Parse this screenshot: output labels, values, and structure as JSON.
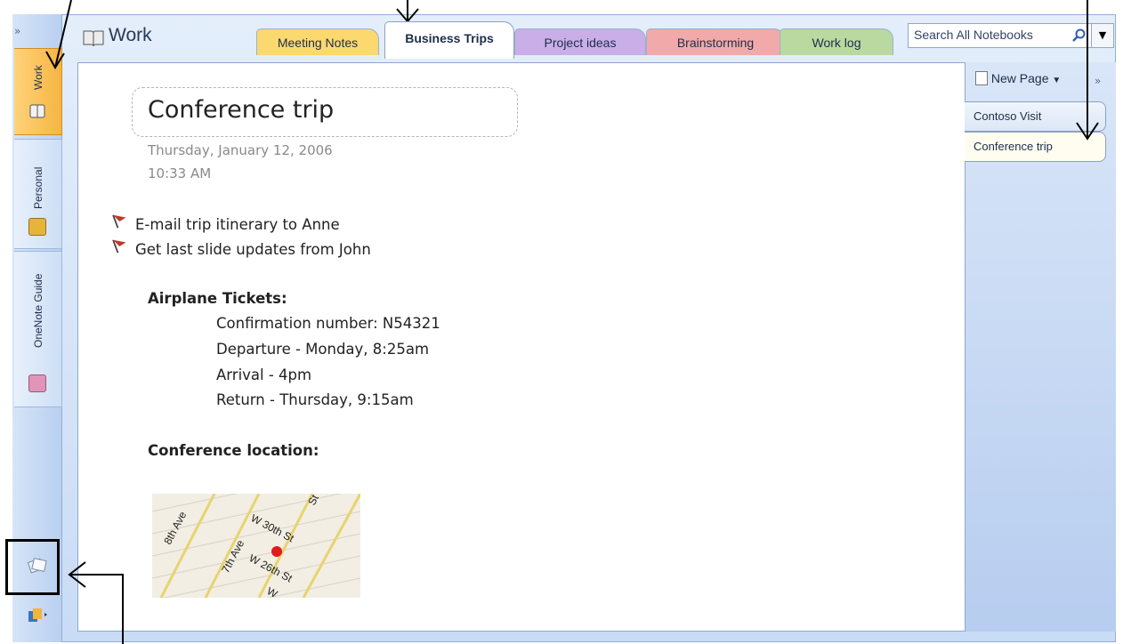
{
  "notebook": {
    "title": "Work"
  },
  "notebooks": [
    {
      "label": "Work",
      "active": true,
      "color": "#b8860b"
    },
    {
      "label": "Personal",
      "active": false,
      "color": "#e2b23a"
    },
    {
      "label": "OneNote Guide",
      "active": false,
      "color": "#d88bb0"
    }
  ],
  "nav": {
    "collapse_label": "»"
  },
  "sections": [
    {
      "label": "Meeting Notes",
      "color": "#fcd96e",
      "active": false
    },
    {
      "label": "Business Trips",
      "color": "#ffffff",
      "active": true
    },
    {
      "label": "Project ideas",
      "color": "#c9aee8",
      "active": false
    },
    {
      "label": "Brainstorming",
      "color": "#f2a9a9",
      "active": false
    },
    {
      "label": "Work log",
      "color": "#b9d9a0",
      "active": false
    }
  ],
  "search": {
    "placeholder": "Search All Notebooks",
    "dropdown_label": "▼"
  },
  "page": {
    "title": "Conference trip",
    "date": "Thursday, January 12, 2006",
    "time": "10:33 AM",
    "tasks": [
      "E-mail trip itinerary to Anne",
      "Get last slide updates from John"
    ],
    "airplane_heading": "Airplane Tickets:",
    "airplane_details": [
      "Confirmation number: N54321",
      "Departure - Monday, 8:25am",
      "Arrival - 4pm",
      "Return - Thursday, 9:15am"
    ],
    "location_heading": "Conference location:",
    "map_labels": [
      "8th Ave",
      "W 30th St",
      "7th Ave",
      "W 26th St",
      "St",
      "W"
    ]
  },
  "page_list": {
    "new_page_label": "New Page",
    "more_label": "»",
    "pages": [
      {
        "label": "Contoso Visit",
        "active": false
      },
      {
        "label": "Conference trip",
        "active": true
      }
    ]
  },
  "colors": {
    "accent": "#f5b543",
    "frame": "#c9dcf5",
    "flag": "#c0392b"
  }
}
